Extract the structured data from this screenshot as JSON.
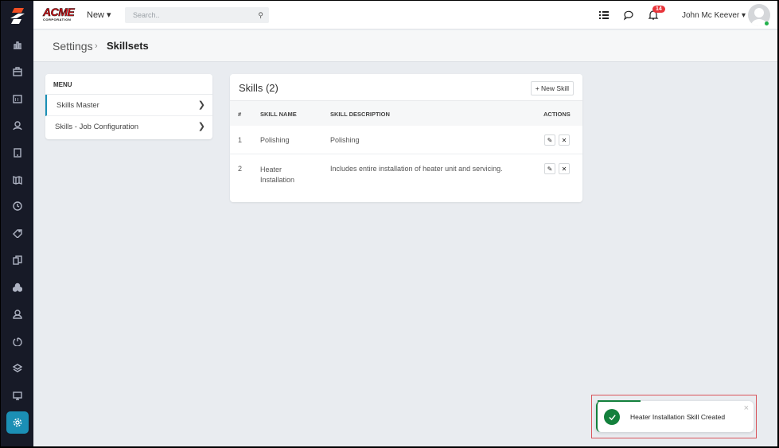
{
  "brand": {
    "logo_text": "ACME",
    "logo_subtext": "CORPORATION"
  },
  "topbar": {
    "new_label": "New ▾",
    "search_placeholder": "Search..",
    "notification_count": "14",
    "user_name": "John Mc Keever ▾"
  },
  "breadcrumb": {
    "parent": "Settings",
    "separator": "›",
    "current": "Skillsets"
  },
  "menu": {
    "title": "MENU",
    "items": [
      {
        "label": "Skills Master",
        "active": true
      },
      {
        "label": "Skills - Job Configuration",
        "active": false
      }
    ]
  },
  "skills": {
    "title": "Skills (2)",
    "new_button": "+ New Skill",
    "columns": [
      "#",
      "SKILL NAME",
      "SKILL DESCRIPTION",
      "ACTIONS"
    ],
    "rows": [
      {
        "num": "1",
        "name": "Polishing",
        "description": "Polishing"
      },
      {
        "num": "2",
        "name": "Heater Installation",
        "description": "Includes entire installation of heater unit and servicing."
      }
    ]
  },
  "toast": {
    "message": "Heater Installation Skill Created",
    "close": "×"
  },
  "colors": {
    "sidebar": "#171a27",
    "accent": "#1b8fb5",
    "success": "#13803c",
    "badge": "#e8343a"
  }
}
